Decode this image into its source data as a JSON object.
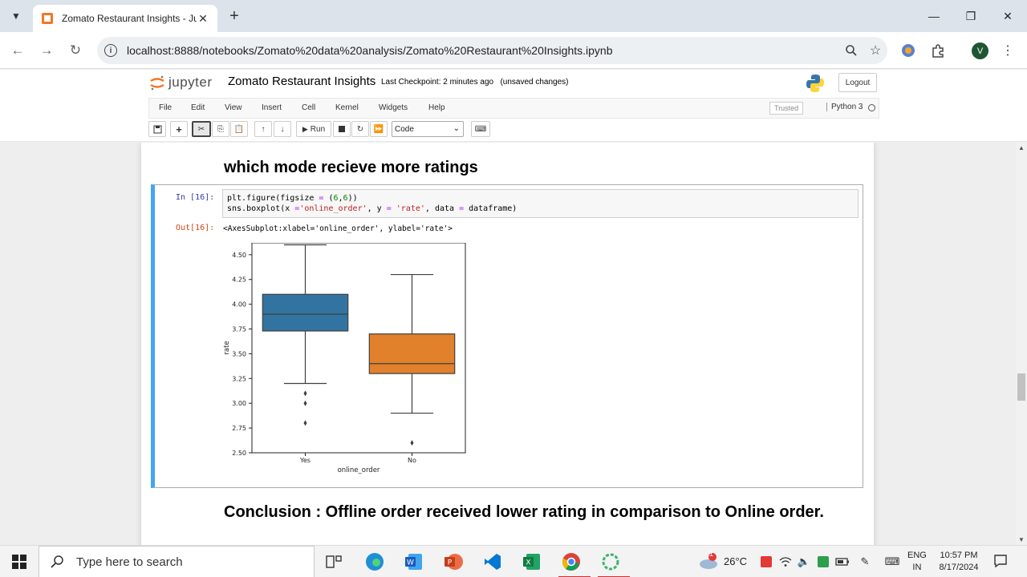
{
  "browser": {
    "tab_title": "Zomato Restaurant Insights - Ju",
    "url": "localhost:8888/notebooks/Zomato%20data%20analysis/Zomato%20Restaurant%20Insights.ipynb",
    "profile_initial": "V"
  },
  "jupyter": {
    "logo_text": "jupyter",
    "notebook_title": "Zomato Restaurant Insights",
    "checkpoint": "Last Checkpoint: 2 minutes ago",
    "unsaved": "(unsaved changes)",
    "logout_label": "Logout",
    "menu": [
      "File",
      "Edit",
      "View",
      "Insert",
      "Cell",
      "Kernel",
      "Widgets",
      "Help"
    ],
    "trusted_label": "Trusted",
    "kernel_name": "Python 3",
    "run_label": "Run",
    "cell_type": "Code"
  },
  "notebook": {
    "heading_top": "which mode recieve more ratings",
    "cell": {
      "in_prompt": "In [16]:",
      "code_line1": {
        "a": "plt.figure(figsize ",
        "op1": "=",
        "b": " (",
        "n1": "6",
        "c": ",",
        "n2": "6",
        "d": "))"
      },
      "code_line2": {
        "a": "sns.boxplot(x ",
        "op1": "=",
        "s1": "'online_order'",
        "b": ", y ",
        "op2": "=",
        "s2": "'rate'",
        "c": ", data ",
        "op3": "=",
        "d": " dataframe)"
      },
      "out_prompt": "Out[16]:",
      "out_text": "<AxesSubplot:xlabel='online_order', ylabel='rate'>"
    },
    "conclusion": "Conclusion : Offline order received lower rating in comparison to Online order."
  },
  "chart_data": {
    "type": "box",
    "title": "",
    "xlabel": "online_order",
    "ylabel": "rate",
    "ylim": [
      2.5,
      4.62
    ],
    "yticks": [
      "2.50",
      "2.75",
      "3.00",
      "3.25",
      "3.50",
      "3.75",
      "4.00",
      "4.25",
      "4.50"
    ],
    "categories": [
      "Yes",
      "No"
    ],
    "boxes": [
      {
        "category": "Yes",
        "whisker_low": 3.2,
        "q1": 3.73,
        "median": 3.9,
        "q3": 4.1,
        "whisker_high": 4.6,
        "outliers": [
          3.1,
          3.0,
          2.8
        ],
        "color": "#3274a1"
      },
      {
        "category": "No",
        "whisker_low": 2.9,
        "q1": 3.3,
        "median": 3.4,
        "q3": 3.7,
        "whisker_high": 4.3,
        "outliers": [
          2.6
        ],
        "color": "#e1812c"
      }
    ],
    "grid": false
  },
  "taskbar": {
    "search_placeholder": "Type here to search",
    "temperature": "26°C",
    "weather_badge": "1",
    "lang_line1": "ENG",
    "lang_line2": "IN",
    "time": "10:57 PM",
    "date": "8/17/2024"
  }
}
